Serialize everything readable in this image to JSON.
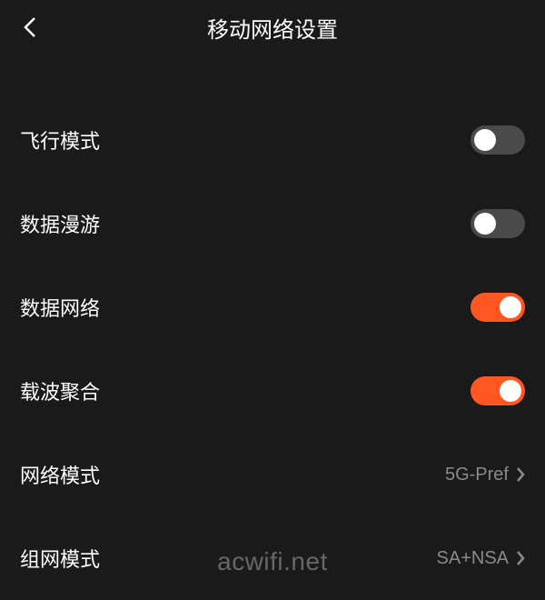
{
  "header": {
    "title": "移动网络设置"
  },
  "settings": [
    {
      "label": "飞行模式",
      "type": "toggle",
      "on": false
    },
    {
      "label": "数据漫游",
      "type": "toggle",
      "on": false
    },
    {
      "label": "数据网络",
      "type": "toggle",
      "on": true
    },
    {
      "label": "载波聚合",
      "type": "toggle",
      "on": true
    },
    {
      "label": "网络模式",
      "type": "link",
      "value": "5G-Pref"
    },
    {
      "label": "组网模式",
      "type": "link",
      "value": "SA+NSA"
    }
  ],
  "colors": {
    "background": "#1a1a1a",
    "accent": "#ff5722",
    "toggleOff": "#4a4a4a",
    "textSecondary": "#8a8a8a"
  },
  "watermark": "acwifi.net"
}
